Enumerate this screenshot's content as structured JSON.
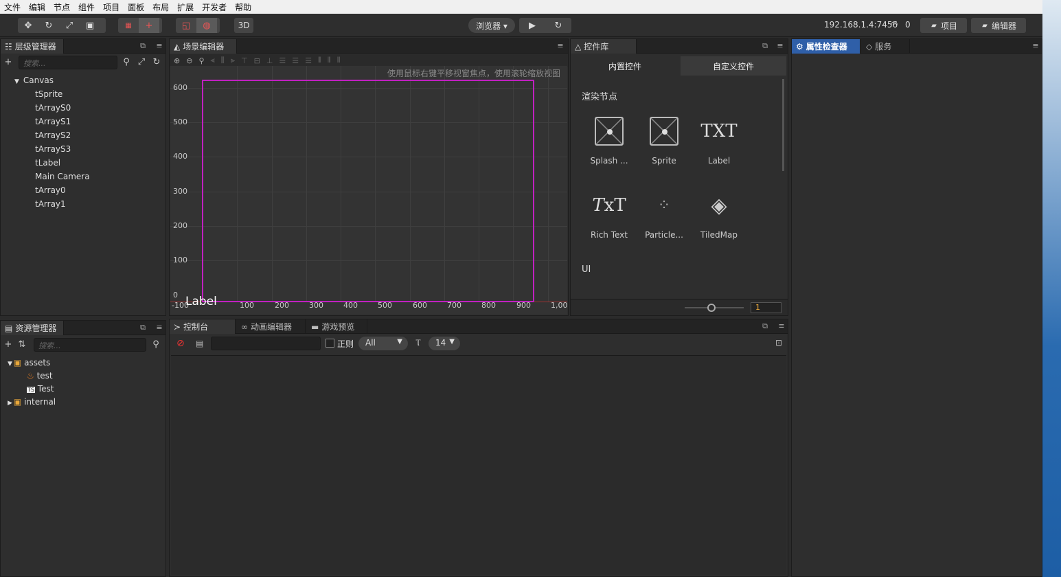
{
  "menu": [
    "文件",
    "编辑",
    "节点",
    "组件",
    "项目",
    "面板",
    "布局",
    "扩展",
    "开发者",
    "帮助"
  ],
  "toolbar": {
    "btn3d": "3D",
    "browser": "浏览器 ▾",
    "ip": "192.168.1.4:7456",
    "clients": "0",
    "project": "项目",
    "editor": "编辑器"
  },
  "hierarchy": {
    "title": "层级管理器",
    "search_placeholder": "搜索...",
    "root": "Canvas",
    "children": [
      "tSprite",
      "tArrayS0",
      "tArrayS1",
      "tArrayS2",
      "tArrayS3",
      "tLabel",
      "Main Camera",
      "tArray0",
      "tArray1"
    ]
  },
  "scene": {
    "title": "场景编辑器",
    "hint": "使用鼠标右键平移视窗焦点，使用滚轮缩放视图",
    "y_ticks": [
      "600",
      "500",
      "400",
      "300",
      "200",
      "100",
      "0"
    ],
    "x_ticks": [
      "-100",
      "100",
      "200",
      "300",
      "400",
      "500",
      "600",
      "700",
      "800",
      "900",
      "1,00"
    ],
    "label_text": "Label"
  },
  "widgets": {
    "title": "控件库",
    "tab_builtin": "内置控件",
    "tab_custom": "自定义控件",
    "section_render": "渲染节点",
    "section_ui": "UI",
    "items": [
      "Splash ...",
      "Sprite",
      "Label",
      "Rich Text",
      "Particle...",
      "TiledMap"
    ],
    "zoom_value": "1"
  },
  "inspector": {
    "title": "属性检查器",
    "services": "服务"
  },
  "assets": {
    "title": "资源管理器",
    "search_placeholder": "搜索...",
    "root": "assets",
    "children": [
      "test",
      "Test"
    ],
    "internal": "internal"
  },
  "console": {
    "tab_console": "控制台",
    "tab_anim": "动画编辑器",
    "tab_preview": "游戏预览",
    "regex": "正则",
    "level": "All",
    "fontsize": "14"
  },
  "colors": {
    "accent": "#2f5fa8",
    "canvas_border": "#c020c0"
  }
}
